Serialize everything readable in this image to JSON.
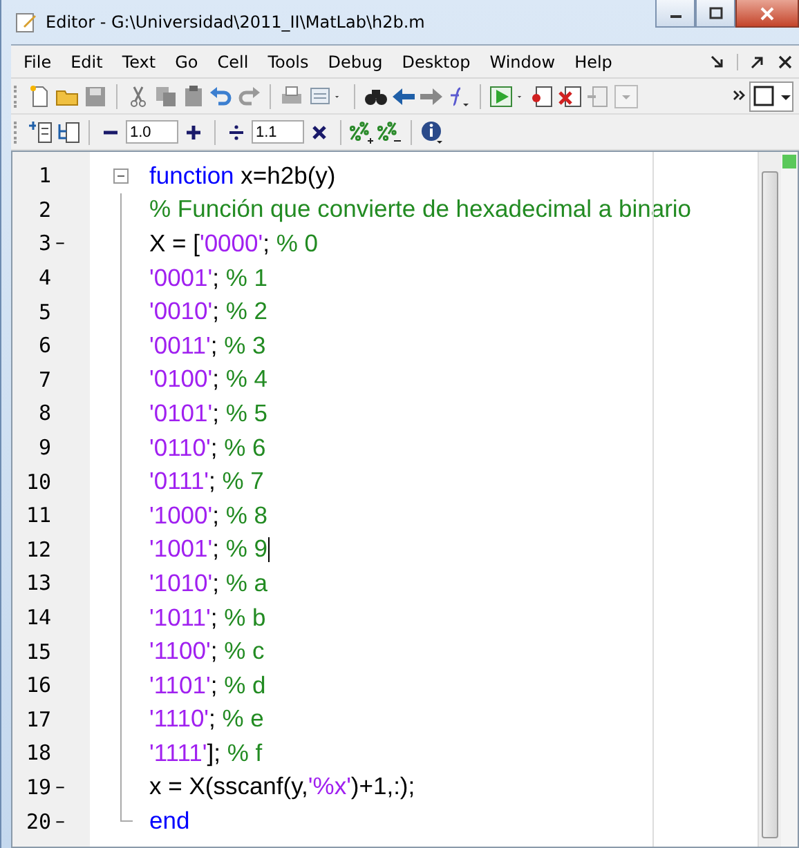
{
  "window": {
    "title": "Editor - G:\\Universidad\\2011_II\\MatLab\\h2b.m"
  },
  "menu": [
    {
      "label": "File"
    },
    {
      "label": "Edit"
    },
    {
      "label": "Text"
    },
    {
      "label": "Go"
    },
    {
      "label": "Cell"
    },
    {
      "label": "Tools"
    },
    {
      "label": "Debug"
    },
    {
      "label": "Desktop"
    },
    {
      "label": "Window"
    },
    {
      "label": "Help"
    }
  ],
  "cell_toolbar": {
    "decrement_value": "1.0",
    "divide_value": "1.1"
  },
  "editor": {
    "lines": [
      {
        "number": "1",
        "kind": "header",
        "cursor": false,
        "segments": [
          {
            "kind": "keyword",
            "text": "function"
          },
          {
            "kind": "plain",
            "text": " x=h2b(y)"
          }
        ]
      },
      {
        "number": "2",
        "kind": "body",
        "cursor": false,
        "segments": [
          {
            "kind": "comment",
            "text": "% Función que convierte de hexadecimal a binario"
          }
        ]
      },
      {
        "number": "3",
        "marker": "–",
        "kind": "body",
        "cursor": false,
        "segments": [
          {
            "kind": "plain",
            "text": "X = ["
          },
          {
            "kind": "string",
            "text": "'0000'"
          },
          {
            "kind": "plain",
            "text": "; "
          },
          {
            "kind": "comment",
            "text": "% 0"
          }
        ]
      },
      {
        "number": "4",
        "kind": "body",
        "cursor": false,
        "segments": [
          {
            "kind": "string",
            "text": "'0001'"
          },
          {
            "kind": "plain",
            "text": "; "
          },
          {
            "kind": "comment",
            "text": "% 1"
          }
        ]
      },
      {
        "number": "5",
        "kind": "body",
        "cursor": false,
        "segments": [
          {
            "kind": "string",
            "text": "'0010'"
          },
          {
            "kind": "plain",
            "text": "; "
          },
          {
            "kind": "comment",
            "text": "% 2"
          }
        ]
      },
      {
        "number": "6",
        "kind": "body",
        "cursor": false,
        "segments": [
          {
            "kind": "string",
            "text": "'0011'"
          },
          {
            "kind": "plain",
            "text": "; "
          },
          {
            "kind": "comment",
            "text": "% 3"
          }
        ]
      },
      {
        "number": "7",
        "kind": "body",
        "cursor": false,
        "segments": [
          {
            "kind": "string",
            "text": "'0100'"
          },
          {
            "kind": "plain",
            "text": "; "
          },
          {
            "kind": "comment",
            "text": "% 4"
          }
        ]
      },
      {
        "number": "8",
        "kind": "body",
        "cursor": false,
        "segments": [
          {
            "kind": "string",
            "text": "'0101'"
          },
          {
            "kind": "plain",
            "text": "; "
          },
          {
            "kind": "comment",
            "text": "% 5"
          }
        ]
      },
      {
        "number": "9",
        "kind": "body",
        "cursor": false,
        "segments": [
          {
            "kind": "string",
            "text": "'0110'"
          },
          {
            "kind": "plain",
            "text": "; "
          },
          {
            "kind": "comment",
            "text": "% 6"
          }
        ]
      },
      {
        "number": "10",
        "kind": "body",
        "cursor": false,
        "segments": [
          {
            "kind": "string",
            "text": "'0111'"
          },
          {
            "kind": "plain",
            "text": "; "
          },
          {
            "kind": "comment",
            "text": "% 7"
          }
        ]
      },
      {
        "number": "11",
        "kind": "body",
        "cursor": false,
        "segments": [
          {
            "kind": "string",
            "text": "'1000'"
          },
          {
            "kind": "plain",
            "text": "; "
          },
          {
            "kind": "comment",
            "text": "% 8"
          }
        ]
      },
      {
        "number": "12",
        "kind": "body",
        "cursor": true,
        "segments": [
          {
            "kind": "string",
            "text": "'1001'"
          },
          {
            "kind": "plain",
            "text": "; "
          },
          {
            "kind": "comment",
            "text": "% 9"
          }
        ]
      },
      {
        "number": "13",
        "kind": "body",
        "cursor": false,
        "segments": [
          {
            "kind": "string",
            "text": "'1010'"
          },
          {
            "kind": "plain",
            "text": "; "
          },
          {
            "kind": "comment",
            "text": "% a"
          }
        ]
      },
      {
        "number": "14",
        "kind": "body",
        "cursor": false,
        "segments": [
          {
            "kind": "string",
            "text": "'1011'"
          },
          {
            "kind": "plain",
            "text": "; "
          },
          {
            "kind": "comment",
            "text": "% b"
          }
        ]
      },
      {
        "number": "15",
        "kind": "body",
        "cursor": false,
        "segments": [
          {
            "kind": "string",
            "text": "'1100'"
          },
          {
            "kind": "plain",
            "text": "; "
          },
          {
            "kind": "comment",
            "text": "% c"
          }
        ]
      },
      {
        "number": "16",
        "kind": "body",
        "cursor": false,
        "segments": [
          {
            "kind": "string",
            "text": "'1101'"
          },
          {
            "kind": "plain",
            "text": "; "
          },
          {
            "kind": "comment",
            "text": "% d"
          }
        ]
      },
      {
        "number": "17",
        "kind": "body",
        "cursor": false,
        "segments": [
          {
            "kind": "string",
            "text": "'1110'"
          },
          {
            "kind": "plain",
            "text": "; "
          },
          {
            "kind": "comment",
            "text": "% e"
          }
        ]
      },
      {
        "number": "18",
        "kind": "body",
        "cursor": false,
        "segments": [
          {
            "kind": "string",
            "text": "'1111'"
          },
          {
            "kind": "plain",
            "text": "]; "
          },
          {
            "kind": "comment",
            "text": "% f"
          }
        ]
      },
      {
        "number": "19",
        "marker": "–",
        "kind": "body",
        "cursor": false,
        "segments": [
          {
            "kind": "plain",
            "text": "x = X(sscanf(y,"
          },
          {
            "kind": "string",
            "text": "'%x'"
          },
          {
            "kind": "plain",
            "text": ")+1,:);"
          }
        ]
      },
      {
        "number": "20",
        "marker": "–",
        "kind": "footer",
        "cursor": false,
        "segments": [
          {
            "kind": "keyword",
            "text": "end"
          }
        ]
      }
    ]
  }
}
